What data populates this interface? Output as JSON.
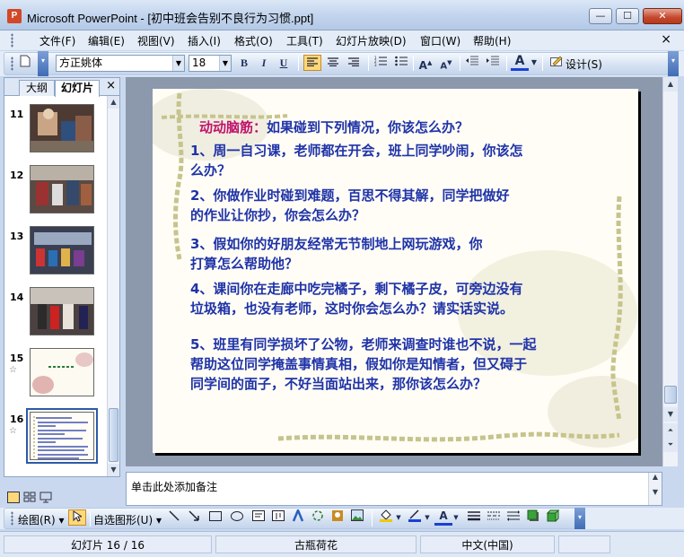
{
  "window": {
    "title": "Microsoft PowerPoint - [初中班会告别不良行为习惯.ppt]",
    "app_icon": "P",
    "minimize_label": "—",
    "maximize_label": "☐",
    "close_label": "✕"
  },
  "menubar": {
    "items": [
      "文件(F)",
      "编辑(E)",
      "视图(V)",
      "插入(I)",
      "格式(O)",
      "工具(T)",
      "幻灯片放映(D)",
      "窗口(W)",
      "帮助(H)"
    ],
    "close_label": "×"
  },
  "toolbar": {
    "font_name": "方正姚体",
    "font_size": "18",
    "bold": "B",
    "italic": "I",
    "underline": "U",
    "design_label": "设计(S)"
  },
  "left_panel": {
    "tabs": [
      "大纲",
      "幻灯片"
    ],
    "close_label": "×",
    "slides": [
      {
        "number": "11",
        "has_anim": false
      },
      {
        "number": "12",
        "has_anim": false
      },
      {
        "number": "13",
        "has_anim": false
      },
      {
        "number": "14",
        "has_anim": false
      },
      {
        "number": "15",
        "has_anim": true
      },
      {
        "number": "16",
        "has_anim": true
      }
    ],
    "anim_icon": "☆"
  },
  "slide": {
    "heading": "动动脑筋：",
    "question": "如果碰到下列情况，你该怎么办？",
    "lines": [
      "1、周一自习课，老师都在开会，班上同学吵闹，你该怎",
      "么办？",
      "2、你做作业时碰到难题，百思不得其解，同学把做好",
      "的作业让你抄，你会怎么办？",
      "3、假如你的好朋友经常无节制地上网玩游戏，你",
      "打算怎么帮助他？",
      "4、课间你在走廊中吃完橘子，剩下橘子皮，可旁边没有",
      "垃圾箱，也没有老师，这时你会怎么办？请实话实说。",
      "5、班里有同学损坏了公物，老师来调查时谁也不说，一起",
      "帮助这位同学掩盖事情真相，假如你是知情者，但又碍于",
      "同学间的面子，不好当面站出来，那你该怎么办？"
    ]
  },
  "notes": {
    "placeholder": "单击此处添加备注"
  },
  "drawing_toolbar": {
    "draw_label": "绘图(R)",
    "autoshape_label": "自选图形(U)"
  },
  "statusbar": {
    "slide_info": "幻灯片 16 / 16",
    "design": "古瓶荷花",
    "language": "中文(中国)"
  },
  "colors": {
    "heading": "#c0136b",
    "body": "#1f33a8",
    "titlebar": "#c3d5ee",
    "active_button": "#ffd87a"
  }
}
